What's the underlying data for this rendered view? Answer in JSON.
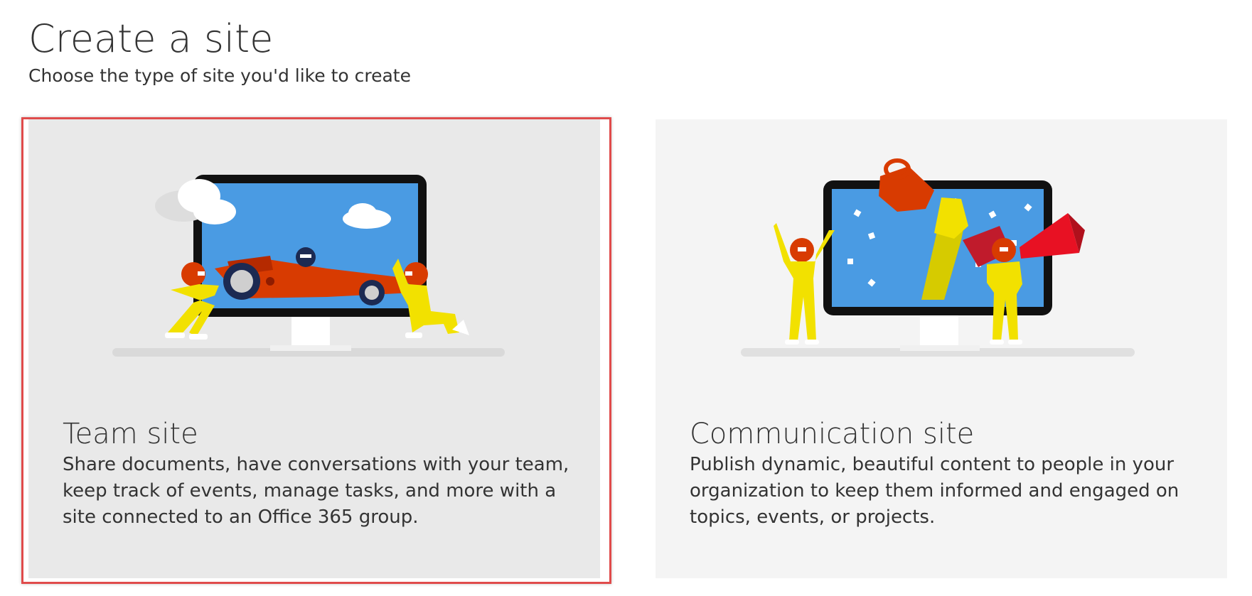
{
  "page": {
    "title": "Create a site",
    "subtitle": "Choose the type of site you'd like to create"
  },
  "cards": [
    {
      "title": "Team site",
      "description": "Share documents, have conversations with your team, keep track of events, manage tasks, and more with a site connected to an Office 365 group.",
      "selected": true,
      "illustration_icon": "race-car-pit-crew-monitor-illustration"
    },
    {
      "title": "Communication site",
      "description": "Publish dynamic, beautiful content to people in your organization to keep them informed and engaged on topics, events, or projects.",
      "selected": false,
      "illustration_icon": "trophy-megaphone-celebration-monitor-illustration"
    }
  ],
  "colors": {
    "selection_border": "#e04b4b",
    "screen_blue": "#4a9be3",
    "crew_yellow": "#f2e100",
    "helmet_red": "#d83b01"
  }
}
